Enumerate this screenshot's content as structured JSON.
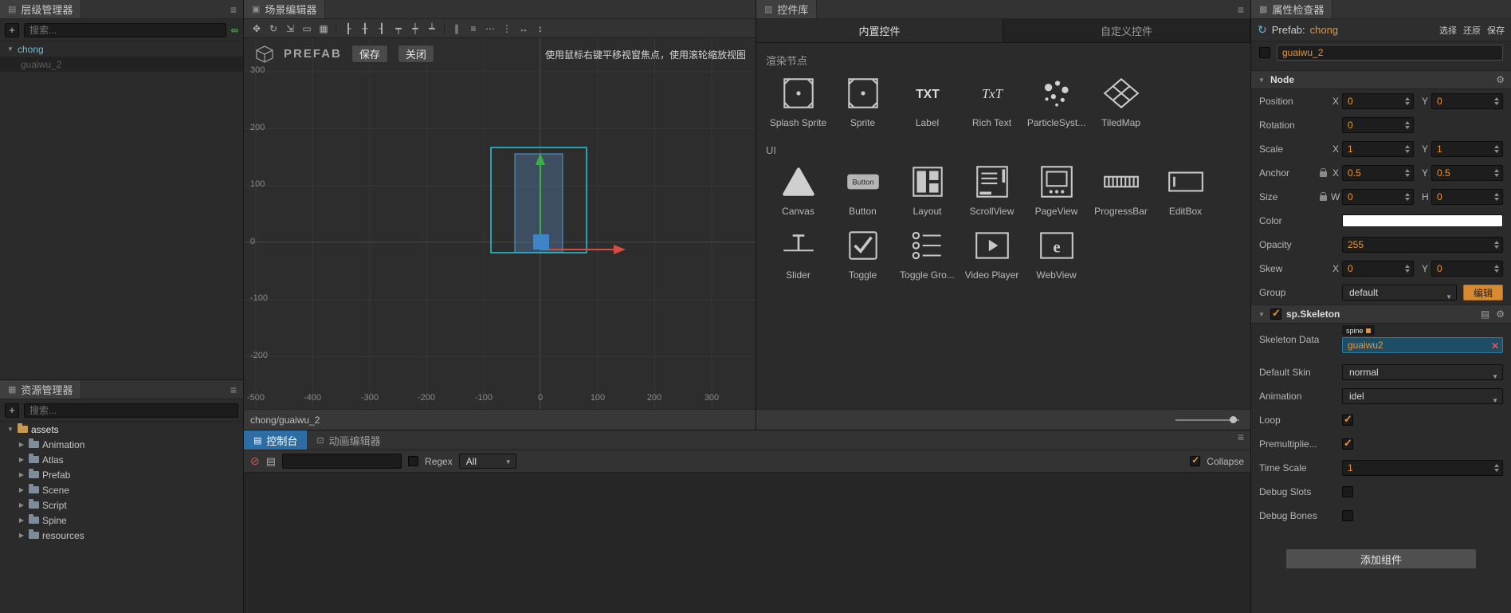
{
  "colors": {
    "accent_orange": "#E8953A",
    "selection_cyan": "#26C6DA",
    "active_tab_blue": "#2E6DA4",
    "gizmo_green": "#3FAE49",
    "gizmo_red": "#D84B40",
    "gizmo_blue": "#3E84C6"
  },
  "hierarchy": {
    "title": "层级管理器",
    "add_label": "+",
    "search_placeholder": "搜索...",
    "root_node": "chong",
    "child_node": "guaiwu_2"
  },
  "assets": {
    "title": "资源管理器",
    "add_label": "+",
    "search_placeholder": "搜索...",
    "root": "assets",
    "folders": [
      "Animation",
      "Atlas",
      "Prefab",
      "Scene",
      "Script",
      "Spine",
      "resources"
    ]
  },
  "scene": {
    "title": "场景编辑器",
    "toolbar": [
      {
        "name": "move-tool",
        "glyph": "✥"
      },
      {
        "name": "rotate-tool",
        "glyph": "↻"
      },
      {
        "name": "scale-tool",
        "glyph": "⇲"
      },
      {
        "name": "rect-transform-tool",
        "glyph": "▭"
      },
      {
        "name": "region-select-tool",
        "glyph": "▦"
      },
      {
        "name": "align-left",
        "glyph": "┠"
      },
      {
        "name": "align-horizontal-center",
        "glyph": "╂"
      },
      {
        "name": "align-right",
        "glyph": "┨"
      },
      {
        "name": "align-top",
        "glyph": "┯"
      },
      {
        "name": "align-vertical-center",
        "glyph": "┿"
      },
      {
        "name": "align-bottom",
        "glyph": "┷"
      },
      {
        "name": "distribute-horizontal",
        "glyph": "∥"
      },
      {
        "name": "distribute-vertical",
        "glyph": "≡"
      },
      {
        "name": "space-horizontal",
        "glyph": "⋯"
      },
      {
        "name": "space-vertical",
        "glyph": "⋮"
      },
      {
        "name": "match-width",
        "glyph": "↔"
      },
      {
        "name": "match-height",
        "glyph": "↕"
      }
    ],
    "prefab_banner": {
      "label": "PREFAB",
      "save": "保存",
      "close": "关闭"
    },
    "hint": "使用鼠标右键平移视窗焦点，使用滚轮缩放视图",
    "ruler_y": [
      "300",
      "200",
      "100",
      "0",
      "-100",
      "-200"
    ],
    "ruler_x": [
      "-500",
      "-400",
      "-300",
      "-200",
      "-100",
      "0",
      "100",
      "200",
      "300"
    ],
    "status_path": "chong/guaiwu_2"
  },
  "widget_library": {
    "title": "控件库",
    "tabs": [
      "内置控件",
      "自定义控件"
    ],
    "sections": [
      {
        "title": "渲染节点",
        "items": [
          "Splash Sprite",
          "Sprite",
          "Label",
          "Rich Text",
          "ParticleSyst...",
          "TiledMap"
        ]
      },
      {
        "title": "UI",
        "items": [
          "Canvas",
          "Button",
          "Layout",
          "ScrollView",
          "PageView",
          "ProgressBar",
          "EditBox",
          "Slider",
          "Toggle",
          "Toggle Gro...",
          "Video Player",
          "WebView"
        ]
      }
    ]
  },
  "console": {
    "tab": "控制台",
    "animation_tab": "动画编辑器",
    "search_value": "",
    "regex_label": "Regex",
    "regex_checked": false,
    "filter_value": "All",
    "collapse_label": "Collapse",
    "collapse_checked": true
  },
  "inspector": {
    "title": "属性检查器",
    "prefab": {
      "label": "Prefab:",
      "name": "chong",
      "actions": [
        "选择",
        "还原",
        "保存"
      ]
    },
    "node_active_checked": false,
    "node_name": "guaiwu_2",
    "axis": {
      "x": "X",
      "y": "Y",
      "w": "W",
      "h": "H"
    },
    "node": {
      "title": "Node",
      "position": {
        "label": "Position",
        "x": "0",
        "y": "0"
      },
      "rotation": {
        "label": "Rotation",
        "value": "0"
      },
      "scale": {
        "label": "Scale",
        "x": "1",
        "y": "1"
      },
      "anchor": {
        "label": "Anchor",
        "x": "0.5",
        "y": "0.5"
      },
      "size": {
        "label": "Size",
        "w": "0",
        "h": "0"
      },
      "color": {
        "label": "Color",
        "value": "#FFFFFF"
      },
      "opacity": {
        "label": "Opacity",
        "value": "255"
      },
      "skew": {
        "label": "Skew",
        "x": "0",
        "y": "0"
      },
      "group": {
        "label": "Group",
        "value": "default",
        "edit": "编辑"
      }
    },
    "skeleton": {
      "title": "sp.Skeleton",
      "enabled": true,
      "skeleton_data": {
        "label": "Skeleton Data",
        "badge": "spine",
        "value": "guaiwu2"
      },
      "default_skin": {
        "label": "Default Skin",
        "value": "normal"
      },
      "animation": {
        "label": "Animation",
        "value": "idel"
      },
      "loop": {
        "label": "Loop",
        "checked": true
      },
      "premultiplied": {
        "label": "Premultiplie...",
        "checked": true
      },
      "time_scale": {
        "label": "Time Scale",
        "value": "1"
      },
      "debug_slots": {
        "label": "Debug Slots",
        "checked": false
      },
      "debug_bones": {
        "label": "Debug Bones",
        "checked": false
      }
    },
    "add_component": "添加组件"
  }
}
